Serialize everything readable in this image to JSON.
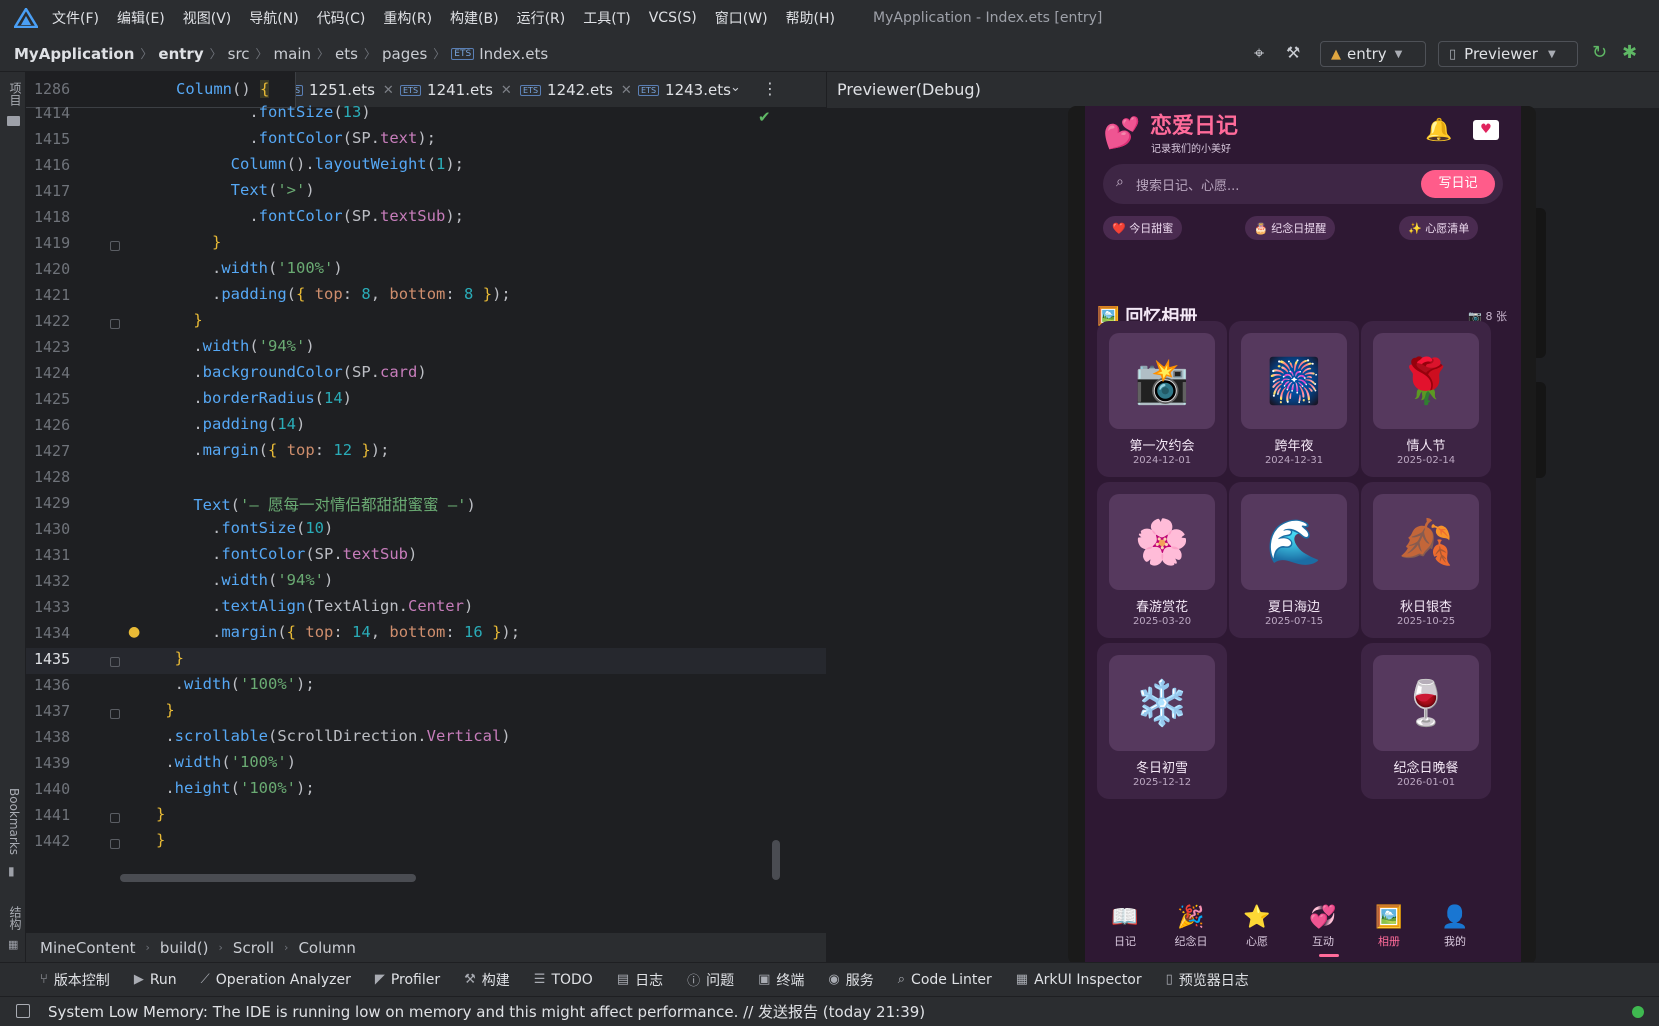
{
  "menubar": {
    "items": [
      "文件(F)",
      "编辑(E)",
      "视图(V)",
      "导航(N)",
      "代码(C)",
      "重构(R)",
      "构建(B)",
      "运行(R)",
      "工具(T)",
      "VCS(S)",
      "窗口(W)",
      "帮助(H)"
    ],
    "window_title": "MyApplication - Index.ets [entry]"
  },
  "navbar": {
    "crumbs": [
      "MyApplication",
      "entry",
      "src",
      "main",
      "ets",
      "pages",
      "Index.ets"
    ],
    "entry_label": "entry",
    "previewer_label": "Previewer"
  },
  "side": {
    "project": "项目",
    "bookmarks": "Bookmarks",
    "structure": "结构"
  },
  "editor": {
    "sticky": "Column() {",
    "sticky_line": "1286",
    "tabs": [
      "1251.ets",
      "1241.ets",
      "1242.ets",
      "1243.ets"
    ],
    "lines": [
      {
        "n": "1414",
        "t": "          .fontSize(13)"
      },
      {
        "n": "1415",
        "t": "          .fontColor(SP.text);"
      },
      {
        "n": "1416",
        "t": "        Column().layoutWeight(1);"
      },
      {
        "n": "1417",
        "t": "        Text('>')"
      },
      {
        "n": "1418",
        "t": "          .fontColor(SP.textSub);"
      },
      {
        "n": "1419",
        "t": "      }"
      },
      {
        "n": "1420",
        "t": "      .width('100%')"
      },
      {
        "n": "1421",
        "t": "      .padding({ top: 8, bottom: 8 });"
      },
      {
        "n": "1422",
        "t": "    }"
      },
      {
        "n": "1423",
        "t": "    .width('94%')"
      },
      {
        "n": "1424",
        "t": "    .backgroundColor(SP.card)"
      },
      {
        "n": "1425",
        "t": "    .borderRadius(14)"
      },
      {
        "n": "1426",
        "t": "    .padding(14)"
      },
      {
        "n": "1427",
        "t": "    .margin({ top: 12 });"
      },
      {
        "n": "1428",
        "t": ""
      },
      {
        "n": "1429",
        "t": "    Text('— 愿每一对情侣都甜甜蜜蜜 —')"
      },
      {
        "n": "1430",
        "t": "      .fontSize(10)"
      },
      {
        "n": "1431",
        "t": "      .fontColor(SP.textSub)"
      },
      {
        "n": "1432",
        "t": "      .width('94%')"
      },
      {
        "n": "1433",
        "t": "      .textAlign(TextAlign.Center)"
      },
      {
        "n": "1434",
        "t": "      .margin({ top: 14, bottom: 16 });"
      },
      {
        "n": "1435",
        "t": "  }"
      },
      {
        "n": "1436",
        "t": "  .width('100%');"
      },
      {
        "n": "1437",
        "t": " }"
      },
      {
        "n": "1438",
        "t": " .scrollable(ScrollDirection.Vertical)"
      },
      {
        "n": "1439",
        "t": " .width('100%')"
      },
      {
        "n": "1440",
        "t": " .height('100%');"
      },
      {
        "n": "1441",
        "t": "}"
      },
      {
        "n": "1442",
        "t": "}"
      }
    ],
    "breadcrumb": [
      "MineContent",
      "build()",
      "Scroll",
      "Column"
    ]
  },
  "toolwindows": [
    "版本控制",
    "Run",
    "Operation Analyzer",
    "Profiler",
    "构建",
    "TODO",
    "日志",
    "问题",
    "终端",
    "服务",
    "Code Linter",
    "ArkUI Inspector",
    "预览器日志"
  ],
  "status": {
    "message": "System Low Memory: The IDE is running low on memory and this might affect performance. // 发送报告 (today 21:39)"
  },
  "previewer": {
    "title": "Previewer(Debug)",
    "app": {
      "title": "恋爱日记",
      "subtitle": "记录我们的小美好",
      "search_placeholder": "搜索日记、心愿...",
      "write_button": "写日记",
      "chips": [
        "❤️ 今日甜蜜",
        "🎂 纪念日提醒",
        "✨ 心愿清单"
      ],
      "section_title": "回忆相册",
      "section_count": "📷 8 张",
      "photos": [
        {
          "emoji": "📸",
          "name": "第一次约会",
          "date": "2024-12-01"
        },
        {
          "emoji": "🎆",
          "name": "跨年夜",
          "date": "2024-12-31"
        },
        {
          "emoji": "🌹",
          "name": "情人节",
          "date": "2025-02-14"
        },
        {
          "emoji": "🌸",
          "name": "春游赏花",
          "date": "2025-03-20"
        },
        {
          "emoji": "🌊",
          "name": "夏日海边",
          "date": "2025-07-15"
        },
        {
          "emoji": "🍂",
          "name": "秋日银杏",
          "date": "2025-10-25"
        },
        {
          "emoji": "❄️",
          "name": "冬日初雪",
          "date": "2025-12-12"
        },
        {
          "emoji": "🍷",
          "name": "纪念日晚餐",
          "date": "2026-01-01"
        }
      ],
      "bottom_nav": [
        {
          "icon": "📖",
          "label": "日记"
        },
        {
          "icon": "🎉",
          "label": "纪念日"
        },
        {
          "icon": "⭐",
          "label": "心愿"
        },
        {
          "icon": "💞",
          "label": "互动"
        },
        {
          "icon": "🖼️",
          "label": "相册"
        },
        {
          "icon": "👤",
          "label": "我的"
        }
      ],
      "accent": "#ff6b9a"
    }
  }
}
